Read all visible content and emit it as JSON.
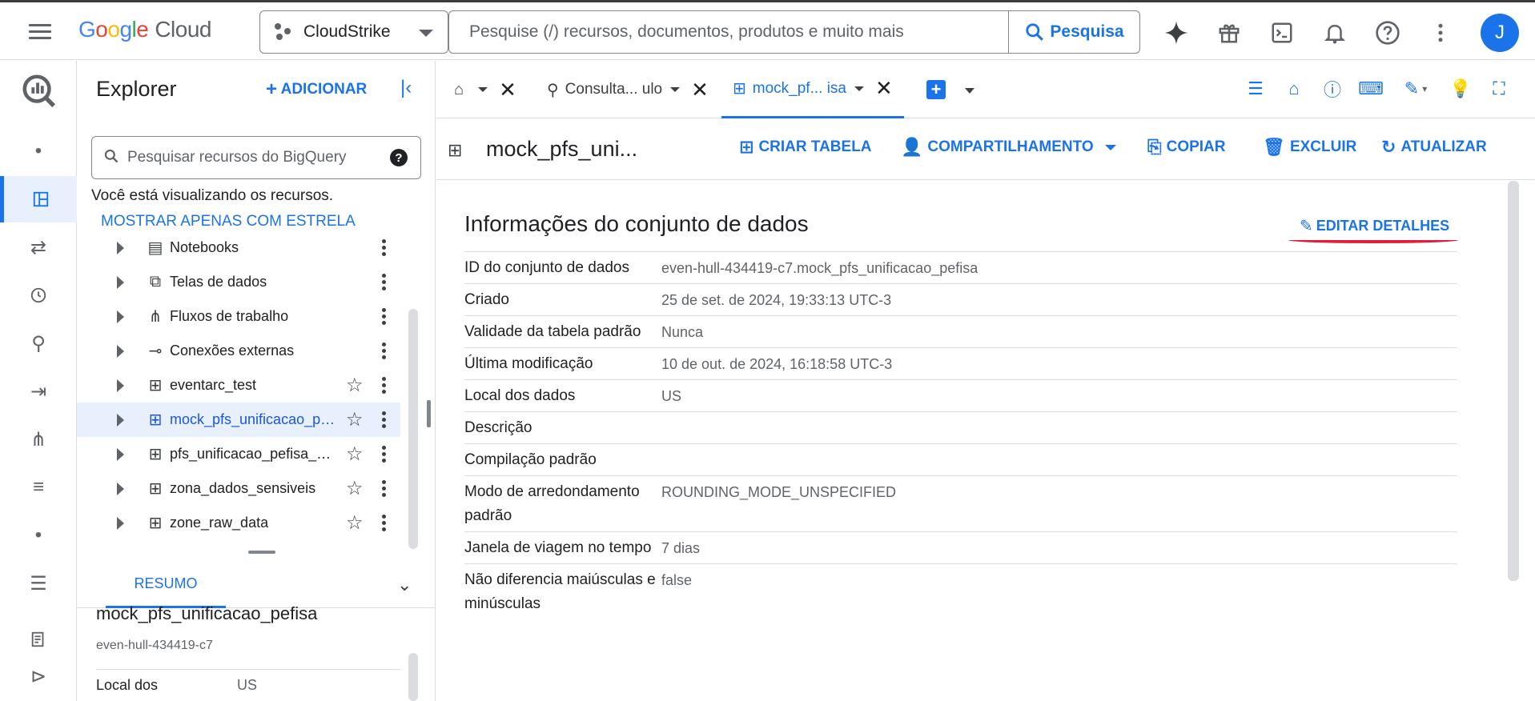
{
  "header": {
    "logo_google": "Google",
    "logo_cloud": "Cloud",
    "project": "CloudStrike",
    "search_placeholder": "Pesquise (/) recursos, documentos, produtos e muito mais",
    "search_button": "Pesquisa",
    "avatar_initial": "J"
  },
  "explorer": {
    "title": "Explorer",
    "add_label": "ADICIONAR",
    "search_placeholder": "Pesquisar recursos do BigQuery",
    "info_text": "Você está visualizando os recursos.",
    "star_link": "MOSTRAR APENAS COM ESTRELA",
    "items": [
      {
        "label": "Notebooks",
        "icon": "notebook-icon"
      },
      {
        "label": "Telas de dados",
        "icon": "data-canvas-icon"
      },
      {
        "label": "Fluxos de trabalho",
        "icon": "workflow-icon"
      },
      {
        "label": "Conexões externas",
        "icon": "connection-icon"
      },
      {
        "label": "eventarc_test",
        "icon": "dataset-icon"
      },
      {
        "label": "mock_pfs_unificacao_pefisa",
        "icon": "dataset-icon"
      },
      {
        "label": "pfs_unificacao_pefisa_mock",
        "icon": "dataset-icon"
      },
      {
        "label": "zona_dados_sensiveis",
        "icon": "dataset-icon"
      },
      {
        "label": "zone_raw_data",
        "icon": "dataset-icon"
      }
    ],
    "bottom_tab": "RESUMO",
    "summary": {
      "title": "mock_pfs_unificacao_pefisa",
      "project": "even-hull-434419-c7",
      "location_key": "Local dos",
      "location_value": "US"
    }
  },
  "tabs": [
    {
      "label": "",
      "icon": "home-icon"
    },
    {
      "label": "Consulta... ulo",
      "icon": "query-icon"
    },
    {
      "label": "mock_pf... isa",
      "icon": "dataset-icon"
    }
  ],
  "toolbar": {
    "dataset_name": "mock_pfs_uni...",
    "create_table": "CRIAR TABELA",
    "share": "COMPARTILHAMENTO",
    "copy": "COPIAR",
    "delete": "EXCLUIR",
    "refresh": "ATUALIZAR"
  },
  "details": {
    "title": "Informações do conjunto de dados",
    "edit_label": "EDITAR DETALHES",
    "rows": [
      {
        "key": "ID do conjunto de dados",
        "value": "even-hull-434419-c7.mock_pfs_unificacao_pefisa"
      },
      {
        "key": "Criado",
        "value": "25 de set. de 2024, 19:33:13 UTC-3"
      },
      {
        "key": "Validade da tabela padrão",
        "value": "Nunca"
      },
      {
        "key": "Última modificação",
        "value": "10 de out. de 2024, 16:18:58 UTC-3"
      },
      {
        "key": "Local dos dados",
        "value": "US"
      },
      {
        "key": "Descrição",
        "value": ""
      },
      {
        "key": "Compilação padrão",
        "value": ""
      },
      {
        "key": "Modo de arredondamento padrão",
        "value": "ROUNDING_MODE_UNSPECIFIED"
      },
      {
        "key": "Janela de viagem no tempo",
        "value": "7 dias"
      },
      {
        "key": "Não diferencia maiúsculas e minúsculas",
        "value": "false"
      }
    ]
  },
  "colors": {
    "accent": "#1a73e8",
    "highlight": "#e01e37"
  }
}
